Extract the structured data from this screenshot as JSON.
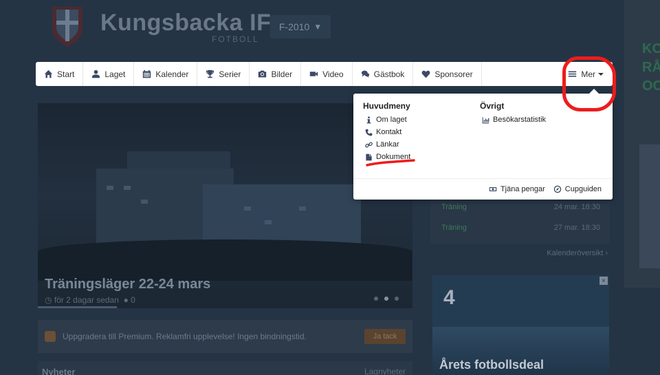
{
  "brand": {
    "title": "Kungsbacka IF",
    "subtitle": "FOTBOLL",
    "team_select": "F-2010"
  },
  "navbar": {
    "items": [
      {
        "label": "Start",
        "icon": "home-icon"
      },
      {
        "label": "Laget",
        "icon": "user-icon"
      },
      {
        "label": "Kalender",
        "icon": "calendar-icon"
      },
      {
        "label": "Serier",
        "icon": "trophy-icon"
      },
      {
        "label": "Bilder",
        "icon": "camera-icon"
      },
      {
        "label": "Video",
        "icon": "video-icon"
      },
      {
        "label": "Gästbok",
        "icon": "comments-icon"
      },
      {
        "label": "Sponsorer",
        "icon": "heart-icon"
      }
    ],
    "more_label": "Mer"
  },
  "dropdown": {
    "main_heading": "Huvudmeny",
    "main_items": [
      {
        "label": "Om laget",
        "icon": "info-icon"
      },
      {
        "label": "Kontakt",
        "icon": "phone-icon"
      },
      {
        "label": "Länkar",
        "icon": "link-icon"
      },
      {
        "label": "Dokument",
        "icon": "document-icon"
      }
    ],
    "other_heading": "Övrigt",
    "other_items": [
      {
        "label": "Besökarstatistik",
        "icon": "bar-chart-icon"
      }
    ],
    "footer": [
      {
        "label": "Tjäna pengar",
        "icon": "money-icon"
      },
      {
        "label": "Cupguiden",
        "icon": "compass-icon"
      }
    ]
  },
  "hero": {
    "title": "Träningsläger 22-24 mars",
    "time": "för 2 dagar sedan",
    "comments": "0"
  },
  "premium": {
    "text": "Uppgradera till Premium. Reklamfri upplevelse! Ingen bindningstid.",
    "button": "Ja tack"
  },
  "news": {
    "title": "Nyheter",
    "filter": "Lagnyheter"
  },
  "calendar": {
    "events": [
      {
        "name": "Träning",
        "date": "24 mar. 18:30"
      },
      {
        "name": "Träning",
        "date": "27 mar. 18:30"
      }
    ],
    "link": "Kalenderöversikt"
  },
  "ad": {
    "logo": "4",
    "text": "Årets fotbollsdeal"
  },
  "side_ad": {
    "text": "KOS RÅ OC"
  },
  "colors": {
    "annotation": "#ee1c1c",
    "navy": "#3d4a66",
    "overlay_bg": "#243445"
  }
}
